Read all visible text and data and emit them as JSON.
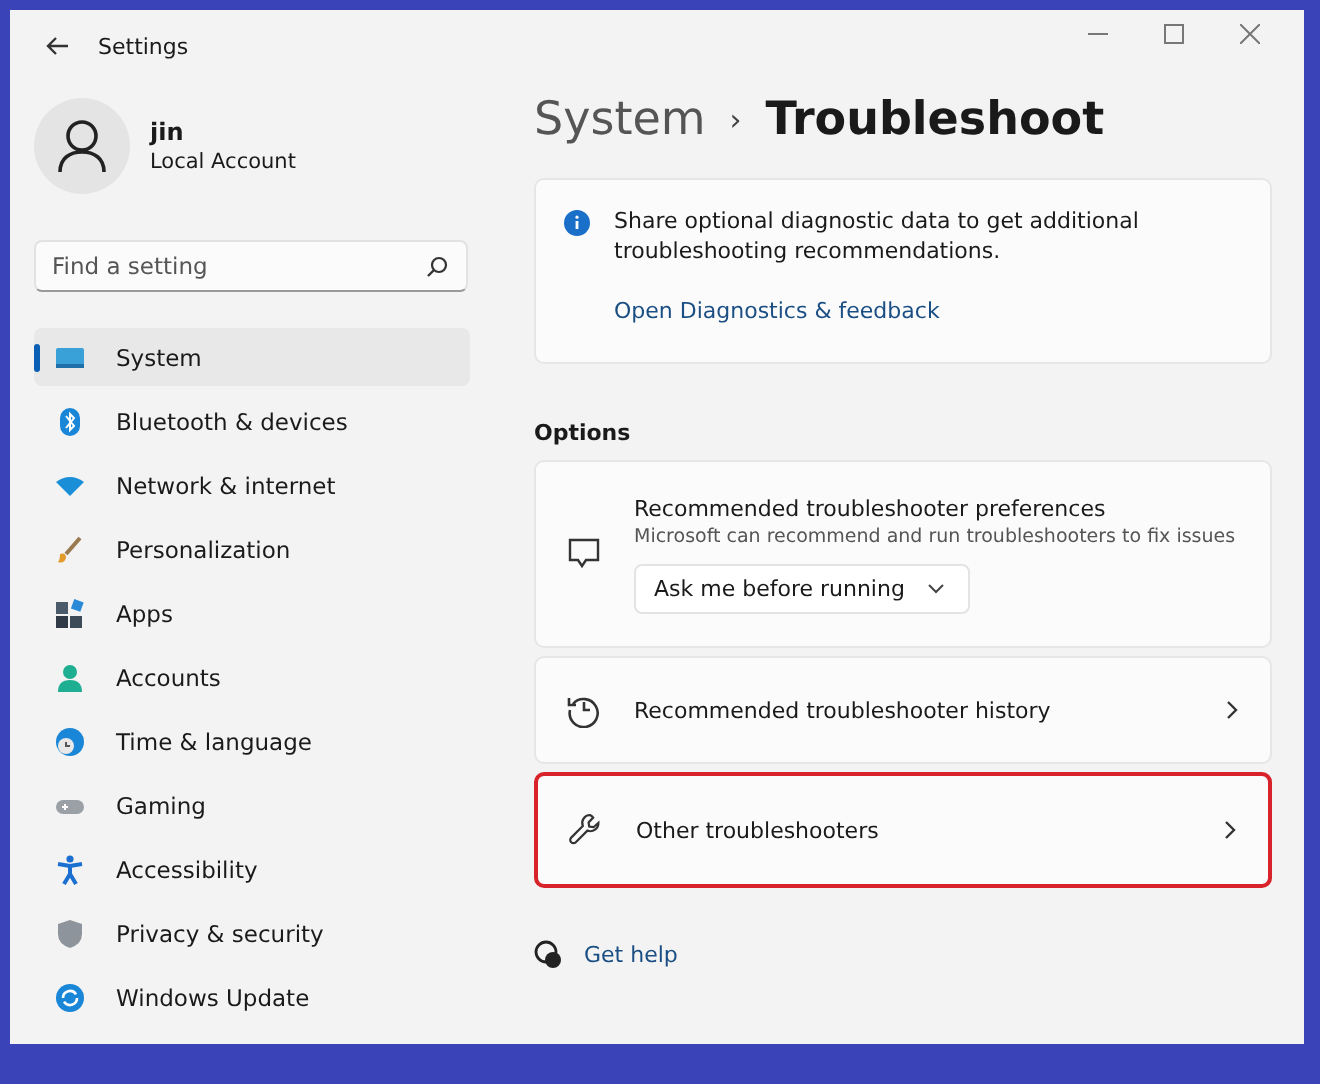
{
  "window": {
    "title": "Settings"
  },
  "account": {
    "name": "jin",
    "type": "Local Account"
  },
  "search": {
    "placeholder": "Find a setting"
  },
  "sidebar": {
    "items": [
      {
        "label": "System",
        "kind": "system",
        "selected": true
      },
      {
        "label": "Bluetooth & devices",
        "kind": "bluetooth",
        "selected": false
      },
      {
        "label": "Network & internet",
        "kind": "network",
        "selected": false
      },
      {
        "label": "Personalization",
        "kind": "brush",
        "selected": false
      },
      {
        "label": "Apps",
        "kind": "apps",
        "selected": false
      },
      {
        "label": "Accounts",
        "kind": "person",
        "selected": false
      },
      {
        "label": "Time & language",
        "kind": "globe",
        "selected": false
      },
      {
        "label": "Gaming",
        "kind": "gamepad",
        "selected": false
      },
      {
        "label": "Accessibility",
        "kind": "accessibility",
        "selected": false
      },
      {
        "label": "Privacy & security",
        "kind": "shield",
        "selected": false
      },
      {
        "label": "Windows Update",
        "kind": "update",
        "selected": false
      }
    ]
  },
  "breadcrumb": {
    "parent": "System",
    "separator": "›",
    "current": "Troubleshoot"
  },
  "info": {
    "text": "Share optional diagnostic data to get additional troubleshooting recommendations.",
    "link": "Open Diagnostics & feedback"
  },
  "options": {
    "heading": "Options",
    "items": [
      {
        "kind": "dropdown",
        "title": "Recommended troubleshooter preferences",
        "description": "Microsoft can recommend and run troubleshooters to fix issues",
        "value": "Ask me before running",
        "highlighted": false
      },
      {
        "kind": "link",
        "title": "Recommended troubleshooter history",
        "highlighted": false
      },
      {
        "kind": "link",
        "title": "Other troubleshooters",
        "highlighted": true
      }
    ]
  },
  "help": {
    "label": "Get help"
  }
}
